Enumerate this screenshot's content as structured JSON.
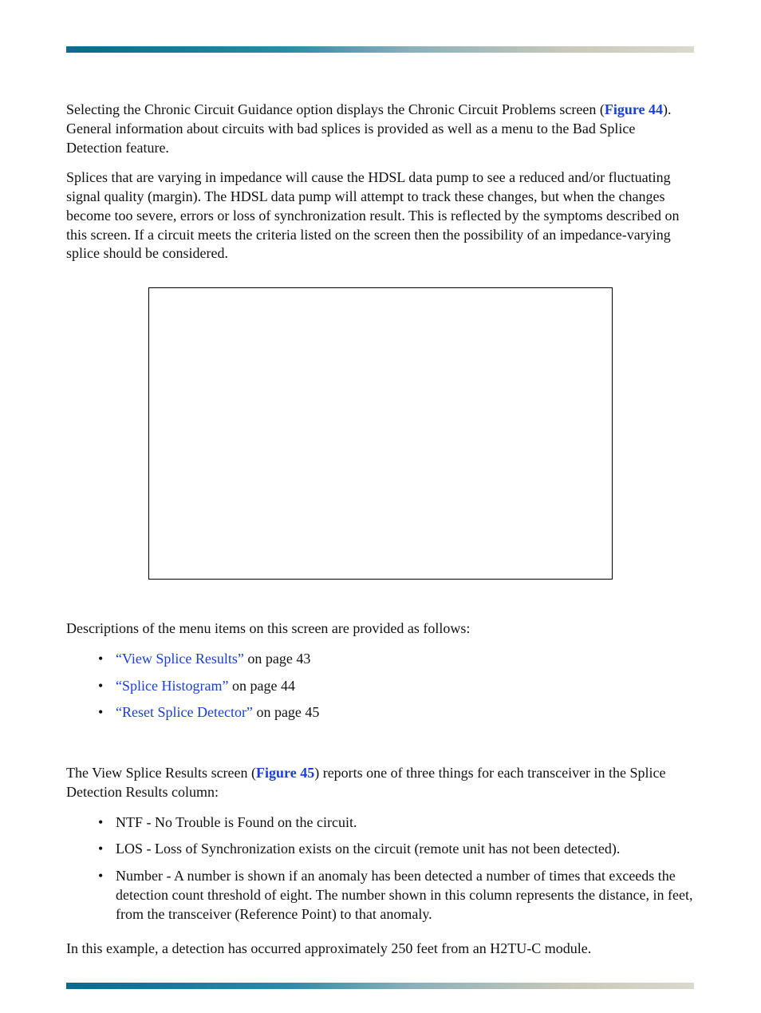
{
  "para1": {
    "t1": "Selecting the Chronic Circuit Guidance option displays the Chronic Circuit Problems screen (",
    "link": "Figure 44",
    "t2": "). General information about circuits with bad splices is provided as well as a menu to the Bad Splice Detection feature."
  },
  "para2": "Splices that are varying in impedance will cause the HDSL data pump to see a reduced and/or fluctuating signal quality (margin). The HDSL data pump will attempt to track these changes, but when the changes become too severe, errors or loss of synchronization result. This is reflected by the symptoms described on this screen. If a circuit meets the criteria listed on the screen then the possibility of an impedance-varying splice should be considered.",
  "para3": "Descriptions of the menu items on this screen are provided as follows:",
  "list1": {
    "i0": {
      "link": "“View Splice Results”",
      "tail": " on page 43"
    },
    "i1": {
      "link": "“Splice Histogram”",
      "tail": " on page 44"
    },
    "i2": {
      "link": "“Reset Splice Detector”",
      "tail": " on page 45"
    }
  },
  "para4": {
    "t1": "The View Splice Results screen (",
    "link": "Figure 45",
    "t2": ") reports one of three things for each transceiver in the Splice Detection Results column:"
  },
  "list2": {
    "i0": "NTF - No Trouble is Found on the circuit.",
    "i1": "LOS - Loss of Synchronization exists on the circuit (remote unit has not been detected).",
    "i2": "Number - A number is shown if an anomaly has been detected a number of times that exceeds the detection count threshold of eight. The number shown in this column represents the distance, in feet, from the transceiver (Reference Point) to that anomaly."
  },
  "para5": "In this example, a detection has occurred approximately 250 feet from an H2TU-C module."
}
